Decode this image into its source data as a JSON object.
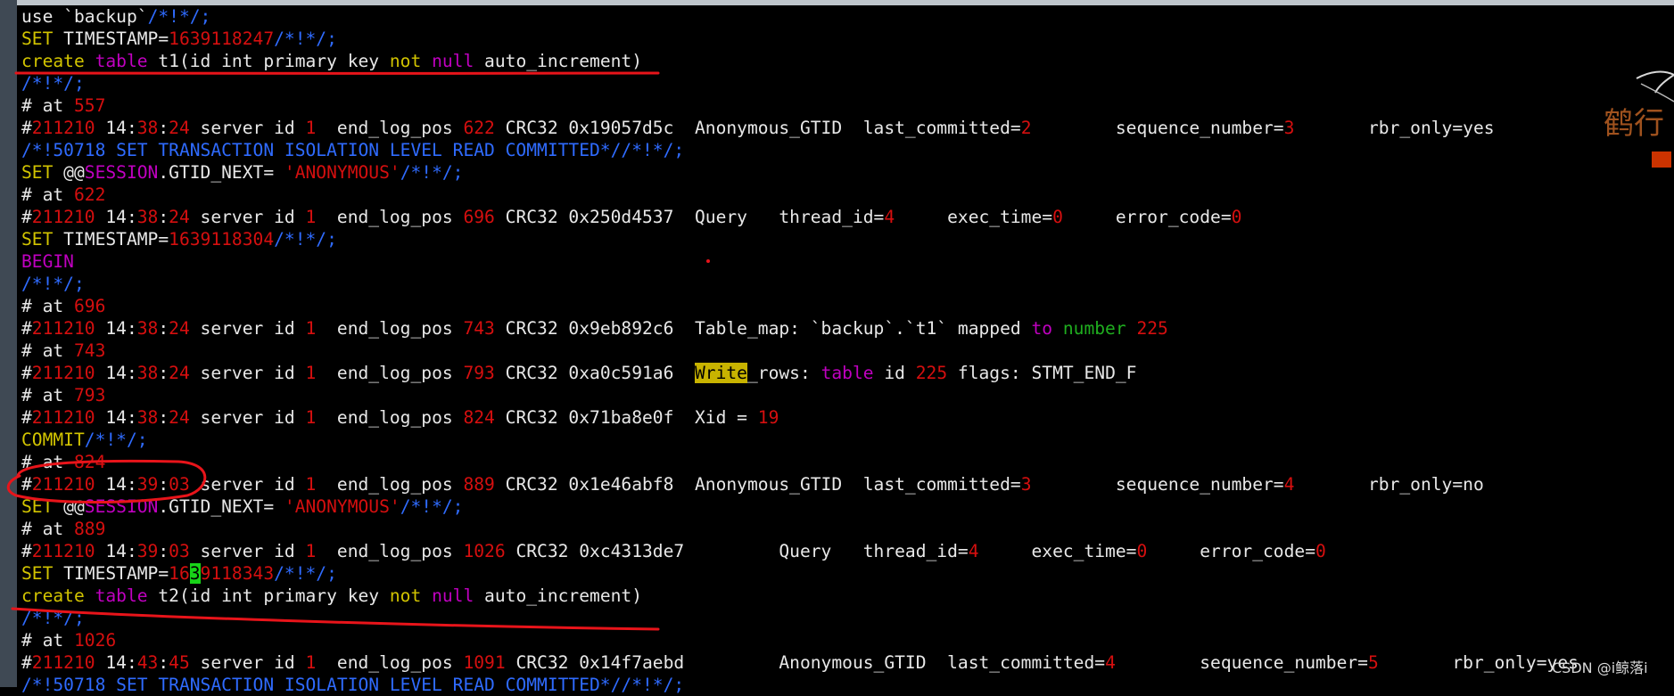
{
  "colors": {
    "background": "#000000",
    "text": "#e8e8e8",
    "keyword": "#d2c400",
    "number": "#d50f0f",
    "comment": "#2f6bff",
    "sql_keyword": "#c000c0",
    "green": "#1fae1f",
    "highlight": "#c8b300",
    "cursor": "#18d418",
    "annotation": "#e8141a",
    "gutter": "#3f4954"
  },
  "terminal": {
    "lines": [
      [
        {
          "t": "use `backup`",
          "c": "text"
        },
        {
          "t": "/*!*/;",
          "c": "blue"
        }
      ],
      [
        {
          "t": "SET",
          "c": "kw"
        },
        {
          "t": " TIMESTAMP=",
          "c": "text"
        },
        {
          "t": "1639118247",
          "c": "red"
        },
        {
          "t": "/*!*/;",
          "c": "blue"
        }
      ],
      [
        {
          "t": "create",
          "c": "kw"
        },
        {
          "t": " ",
          "c": "text"
        },
        {
          "t": "table",
          "c": "mag"
        },
        {
          "t": " t1(id int primary key ",
          "c": "text"
        },
        {
          "t": "not",
          "c": "kw"
        },
        {
          "t": " ",
          "c": "text"
        },
        {
          "t": "null",
          "c": "mag"
        },
        {
          "t": " auto_increment)",
          "c": "text"
        }
      ],
      [
        {
          "t": "/*!*/;",
          "c": "blue"
        }
      ],
      [
        {
          "t": "# at ",
          "c": "text"
        },
        {
          "t": "557",
          "c": "red"
        }
      ],
      [
        {
          "t": "#",
          "c": "text"
        },
        {
          "t": "211210",
          "c": "red"
        },
        {
          "t": " 14:",
          "c": "text"
        },
        {
          "t": "38",
          "c": "red"
        },
        {
          "t": ":",
          "c": "text"
        },
        {
          "t": "24",
          "c": "red"
        },
        {
          "t": " server id ",
          "c": "text"
        },
        {
          "t": "1",
          "c": "red"
        },
        {
          "t": "  end_log_pos ",
          "c": "text"
        },
        {
          "t": "622",
          "c": "red"
        },
        {
          "t": " CRC32 0x19057d5c  Anonymous_GTID  last_committed=",
          "c": "text"
        },
        {
          "t": "2",
          "c": "red"
        },
        {
          "t": "        sequence_number=",
          "c": "text"
        },
        {
          "t": "3",
          "c": "red"
        },
        {
          "t": "       rbr_only=yes",
          "c": "text"
        }
      ],
      [
        {
          "t": "/*!50718 SET TRANSACTION ISOLATION LEVEL READ COMMITTED*//*!*/;",
          "c": "blue"
        }
      ],
      [
        {
          "t": "SET",
          "c": "kw"
        },
        {
          "t": " @@",
          "c": "text"
        },
        {
          "t": "SESSION",
          "c": "mag"
        },
        {
          "t": ".GTID_NEXT= ",
          "c": "text"
        },
        {
          "t": "'ANONYMOUS'",
          "c": "red"
        },
        {
          "t": "/*!*/;",
          "c": "blue"
        }
      ],
      [
        {
          "t": "# at ",
          "c": "text"
        },
        {
          "t": "622",
          "c": "red"
        }
      ],
      [
        {
          "t": "#",
          "c": "text"
        },
        {
          "t": "211210",
          "c": "red"
        },
        {
          "t": " 14:",
          "c": "text"
        },
        {
          "t": "38",
          "c": "red"
        },
        {
          "t": ":",
          "c": "text"
        },
        {
          "t": "24",
          "c": "red"
        },
        {
          "t": " server id ",
          "c": "text"
        },
        {
          "t": "1",
          "c": "red"
        },
        {
          "t": "  end_log_pos ",
          "c": "text"
        },
        {
          "t": "696",
          "c": "red"
        },
        {
          "t": " CRC32 0x250d4537  Query   thread_id=",
          "c": "text"
        },
        {
          "t": "4",
          "c": "red"
        },
        {
          "t": "     exec_time=",
          "c": "text"
        },
        {
          "t": "0",
          "c": "red"
        },
        {
          "t": "     error_code=",
          "c": "text"
        },
        {
          "t": "0",
          "c": "red"
        }
      ],
      [
        {
          "t": "SET",
          "c": "kw"
        },
        {
          "t": " TIMESTAMP=",
          "c": "text"
        },
        {
          "t": "1639118304",
          "c": "red"
        },
        {
          "t": "/*!*/;",
          "c": "blue"
        }
      ],
      [
        {
          "t": "BEGIN",
          "c": "mag"
        }
      ],
      [
        {
          "t": "/*!*/;",
          "c": "blue"
        }
      ],
      [
        {
          "t": "# at ",
          "c": "text"
        },
        {
          "t": "696",
          "c": "red"
        }
      ],
      [
        {
          "t": "#",
          "c": "text"
        },
        {
          "t": "211210",
          "c": "red"
        },
        {
          "t": " 14:",
          "c": "text"
        },
        {
          "t": "38",
          "c": "red"
        },
        {
          "t": ":",
          "c": "text"
        },
        {
          "t": "24",
          "c": "red"
        },
        {
          "t": " server id ",
          "c": "text"
        },
        {
          "t": "1",
          "c": "red"
        },
        {
          "t": "  end_log_pos ",
          "c": "text"
        },
        {
          "t": "743",
          "c": "red"
        },
        {
          "t": " CRC32 0x9eb892c6  Table_map: `backup`.`t1` mapped ",
          "c": "text"
        },
        {
          "t": "to",
          "c": "mag"
        },
        {
          "t": " ",
          "c": "text"
        },
        {
          "t": "number",
          "c": "green"
        },
        {
          "t": " ",
          "c": "text"
        },
        {
          "t": "225",
          "c": "red"
        }
      ],
      [
        {
          "t": "# at ",
          "c": "text"
        },
        {
          "t": "743",
          "c": "red"
        }
      ],
      [
        {
          "t": "#",
          "c": "text"
        },
        {
          "t": "211210",
          "c": "red"
        },
        {
          "t": " 14:",
          "c": "text"
        },
        {
          "t": "38",
          "c": "red"
        },
        {
          "t": ":",
          "c": "text"
        },
        {
          "t": "24",
          "c": "red"
        },
        {
          "t": " server id ",
          "c": "text"
        },
        {
          "t": "1",
          "c": "red"
        },
        {
          "t": "  end_log_pos ",
          "c": "text"
        },
        {
          "t": "793",
          "c": "red"
        },
        {
          "t": " CRC32 0xa0c591a6  ",
          "c": "text"
        },
        {
          "t": "Write",
          "c": "hl"
        },
        {
          "t": "_rows: ",
          "c": "text"
        },
        {
          "t": "table",
          "c": "mag"
        },
        {
          "t": " id ",
          "c": "text"
        },
        {
          "t": "225",
          "c": "red"
        },
        {
          "t": " flags: STMT_END_F",
          "c": "text"
        }
      ],
      [
        {
          "t": "# at ",
          "c": "text"
        },
        {
          "t": "793",
          "c": "red"
        }
      ],
      [
        {
          "t": "#",
          "c": "text"
        },
        {
          "t": "211210",
          "c": "red"
        },
        {
          "t": " 14:",
          "c": "text"
        },
        {
          "t": "38",
          "c": "red"
        },
        {
          "t": ":",
          "c": "text"
        },
        {
          "t": "24",
          "c": "red"
        },
        {
          "t": " server id ",
          "c": "text"
        },
        {
          "t": "1",
          "c": "red"
        },
        {
          "t": "  end_log_pos ",
          "c": "text"
        },
        {
          "t": "824",
          "c": "red"
        },
        {
          "t": " CRC32 0x71ba8e0f  Xid = ",
          "c": "text"
        },
        {
          "t": "19",
          "c": "red"
        }
      ],
      [
        {
          "t": "COMMIT",
          "c": "kw"
        },
        {
          "t": "/*!*/;",
          "c": "blue"
        }
      ],
      [
        {
          "t": "# at ",
          "c": "text"
        },
        {
          "t": "824",
          "c": "red"
        }
      ],
      [
        {
          "t": "#",
          "c": "text"
        },
        {
          "t": "211210",
          "c": "red"
        },
        {
          "t": " 14:",
          "c": "text"
        },
        {
          "t": "39",
          "c": "red"
        },
        {
          "t": ":",
          "c": "text"
        },
        {
          "t": "03",
          "c": "red"
        },
        {
          "t": " server id ",
          "c": "text"
        },
        {
          "t": "1",
          "c": "red"
        },
        {
          "t": "  end_log_pos ",
          "c": "text"
        },
        {
          "t": "889",
          "c": "red"
        },
        {
          "t": " CRC32 0x1e46abf8  Anonymous_GTID  last_committed=",
          "c": "text"
        },
        {
          "t": "3",
          "c": "red"
        },
        {
          "t": "        sequence_number=",
          "c": "text"
        },
        {
          "t": "4",
          "c": "red"
        },
        {
          "t": "       rbr_only=no",
          "c": "text"
        }
      ],
      [
        {
          "t": "SET",
          "c": "kw"
        },
        {
          "t": " @@",
          "c": "text"
        },
        {
          "t": "SESSION",
          "c": "mag"
        },
        {
          "t": ".GTID_NEXT= ",
          "c": "text"
        },
        {
          "t": "'ANONYMOUS'",
          "c": "red"
        },
        {
          "t": "/*!*/;",
          "c": "blue"
        }
      ],
      [
        {
          "t": "# at ",
          "c": "text"
        },
        {
          "t": "889",
          "c": "red"
        }
      ],
      [
        {
          "t": "#",
          "c": "text"
        },
        {
          "t": "211210",
          "c": "red"
        },
        {
          "t": " 14:",
          "c": "text"
        },
        {
          "t": "39",
          "c": "red"
        },
        {
          "t": ":",
          "c": "text"
        },
        {
          "t": "03",
          "c": "red"
        },
        {
          "t": " server id ",
          "c": "text"
        },
        {
          "t": "1",
          "c": "red"
        },
        {
          "t": "  end_log_pos ",
          "c": "text"
        },
        {
          "t": "1026",
          "c": "red"
        },
        {
          "t": " CRC32 0xc4313de7         Query   thread_id=",
          "c": "text"
        },
        {
          "t": "4",
          "c": "red"
        },
        {
          "t": "     exec_time=",
          "c": "text"
        },
        {
          "t": "0",
          "c": "red"
        },
        {
          "t": "     error_code=",
          "c": "text"
        },
        {
          "t": "0",
          "c": "red"
        }
      ],
      [
        {
          "t": "SET",
          "c": "kw"
        },
        {
          "t": " TIMESTAMP=",
          "c": "text"
        },
        {
          "t": "16",
          "c": "red"
        },
        {
          "t": "3",
          "c": "cursor"
        },
        {
          "t": "9118343",
          "c": "red"
        },
        {
          "t": "/*!*/;",
          "c": "blue"
        }
      ],
      [
        {
          "t": "create",
          "c": "kw"
        },
        {
          "t": " ",
          "c": "text"
        },
        {
          "t": "table",
          "c": "mag"
        },
        {
          "t": " t2(id int primary key ",
          "c": "text"
        },
        {
          "t": "not",
          "c": "kw"
        },
        {
          "t": " ",
          "c": "text"
        },
        {
          "t": "null",
          "c": "mag"
        },
        {
          "t": " auto_increment)",
          "c": "text"
        }
      ],
      [
        {
          "t": "/*!*/;",
          "c": "blue"
        }
      ],
      [
        {
          "t": "# at ",
          "c": "text"
        },
        {
          "t": "1026",
          "c": "red"
        }
      ],
      [
        {
          "t": "#",
          "c": "text"
        },
        {
          "t": "211210",
          "c": "red"
        },
        {
          "t": " 14:",
          "c": "text"
        },
        {
          "t": "43",
          "c": "red"
        },
        {
          "t": ":",
          "c": "text"
        },
        {
          "t": "45",
          "c": "red"
        },
        {
          "t": " server id ",
          "c": "text"
        },
        {
          "t": "1",
          "c": "red"
        },
        {
          "t": "  end_log_pos ",
          "c": "text"
        },
        {
          "t": "1091",
          "c": "red"
        },
        {
          "t": " CRC32 0x14f7aebd         Anonymous_GTID  last_committed=",
          "c": "text"
        },
        {
          "t": "4",
          "c": "red"
        },
        {
          "t": "        sequence_number=",
          "c": "text"
        },
        {
          "t": "5",
          "c": "red"
        },
        {
          "t": "       rbr_only=yes",
          "c": "text"
        }
      ],
      [
        {
          "t": "/*!50718 SET TRANSACTION ISOLATION LEVEL READ COMMITTED*//*!*/;",
          "c": "blue"
        }
      ]
    ]
  },
  "logo": {
    "icon": "crane-calligraphy-logo",
    "text": "鹤行"
  },
  "watermark": {
    "text": "CSDN @i鲸落i"
  }
}
